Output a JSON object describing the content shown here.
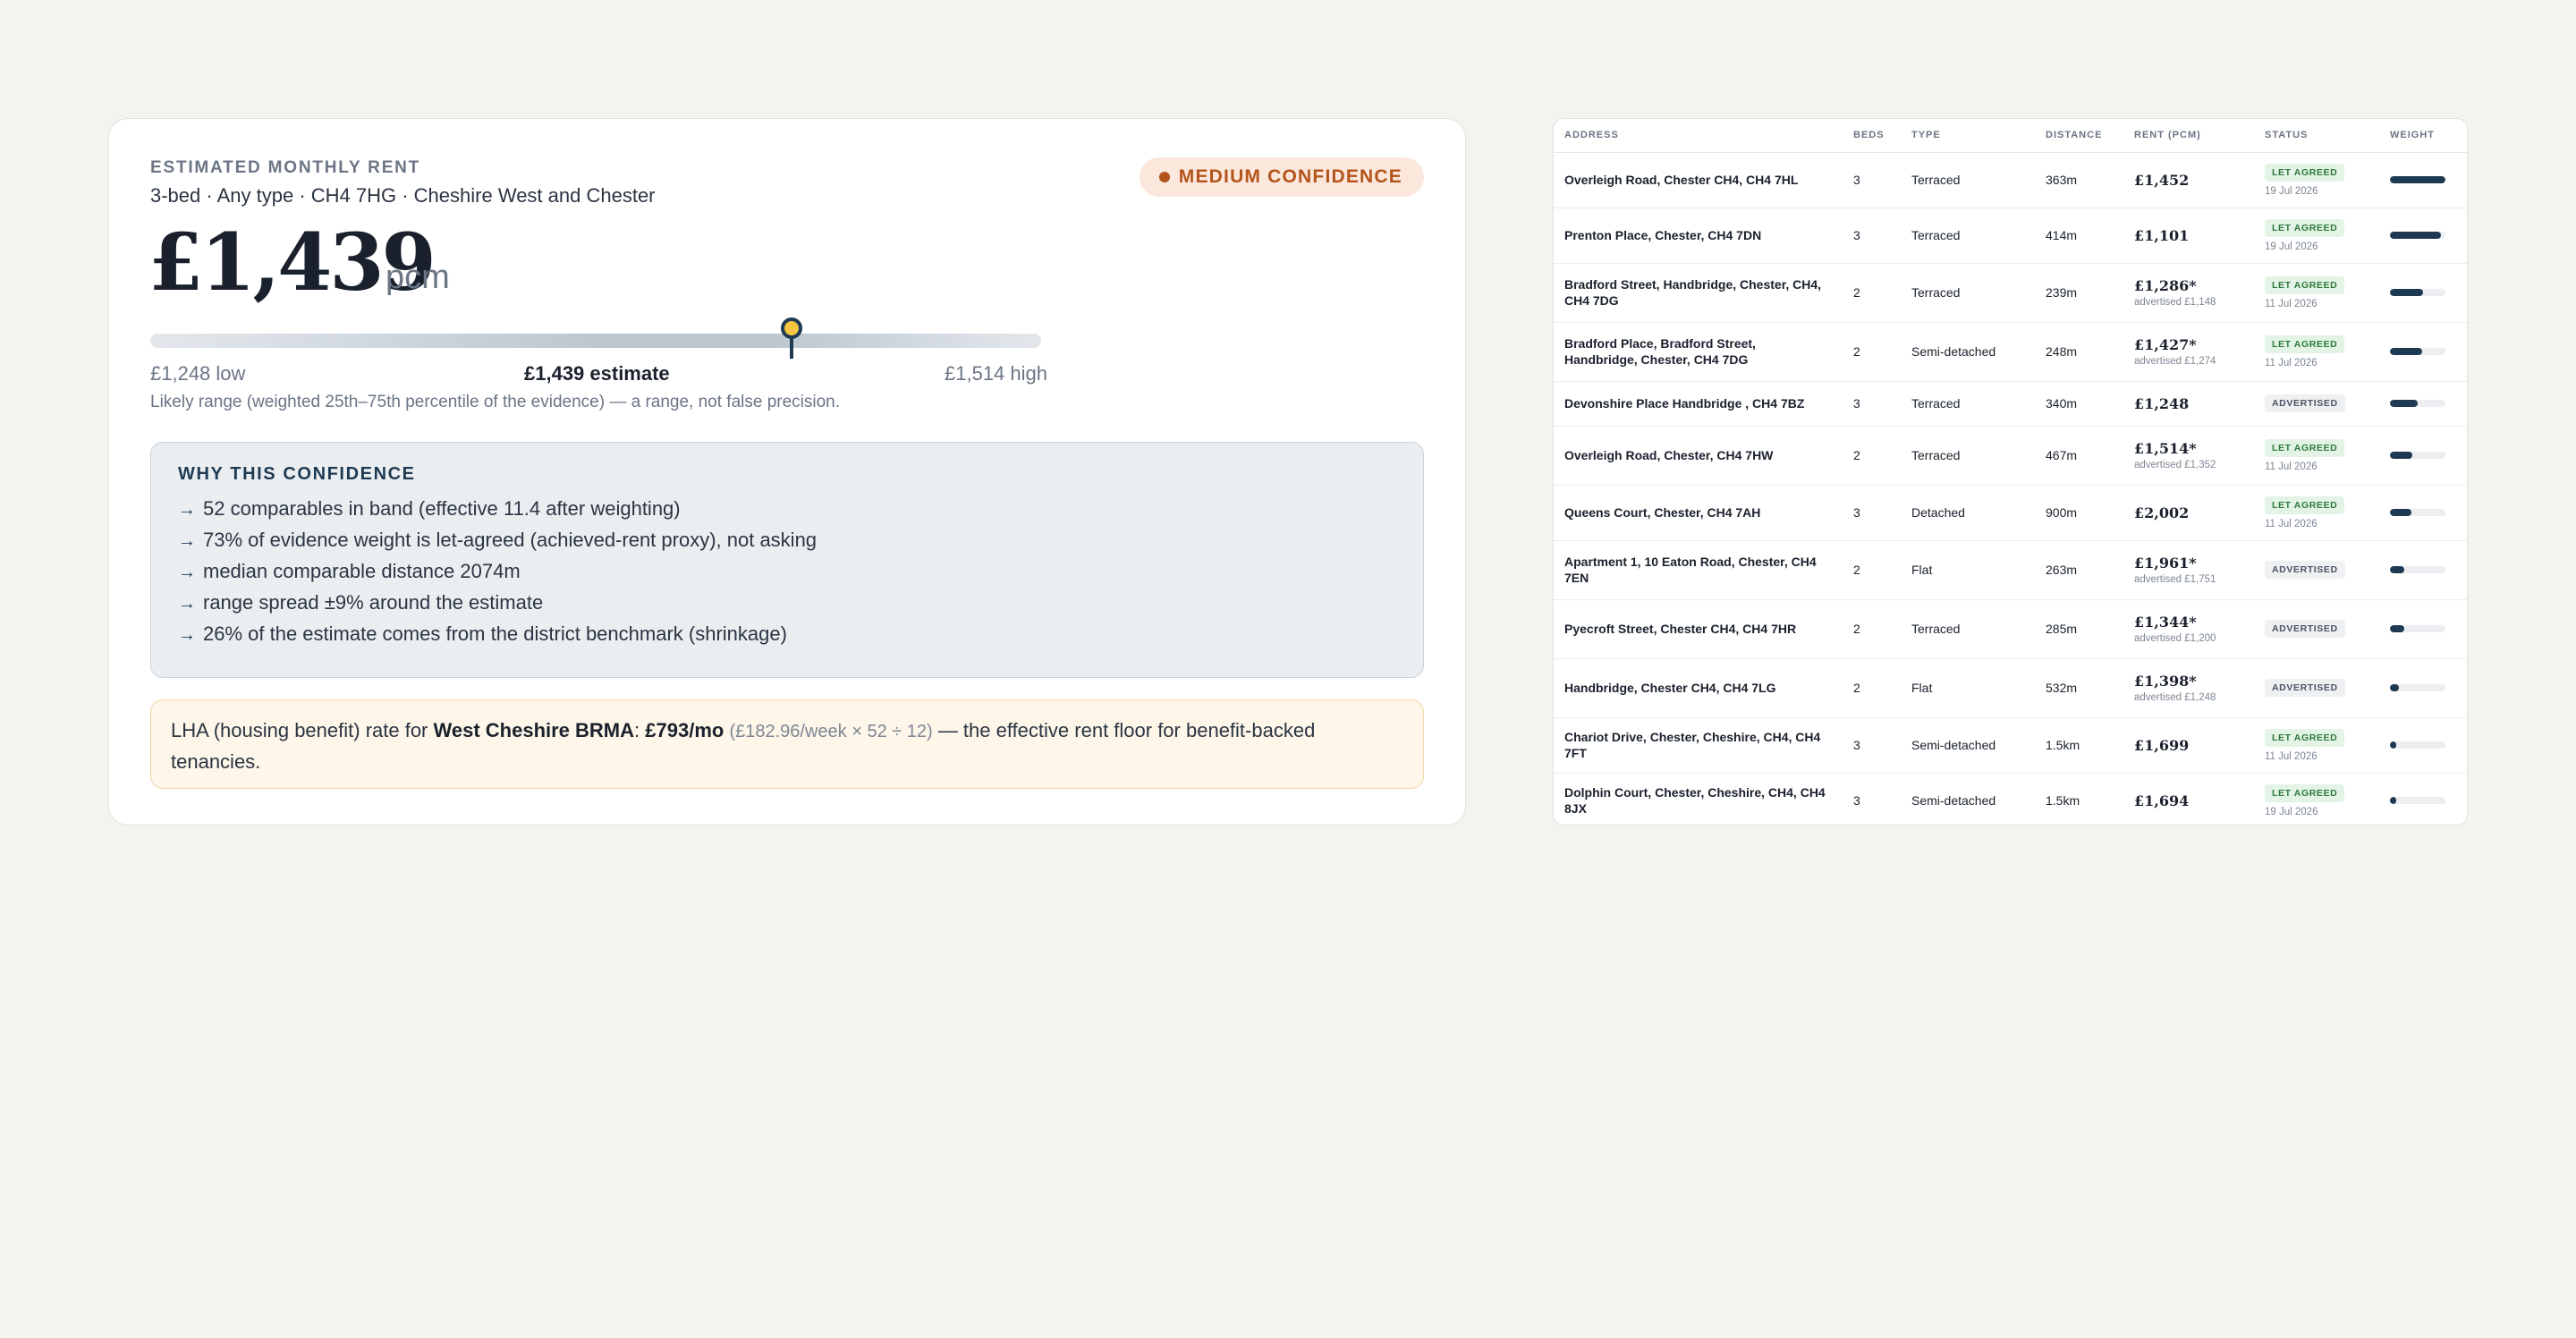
{
  "estimate": {
    "label": "ESTIMATED MONTHLY RENT",
    "subtitle": "3-bed · Any type · CH4 7HG · Cheshire West and Chester",
    "confidence": "MEDIUM CONFIDENCE",
    "value": "£1,439",
    "unit": "pcm",
    "range": {
      "low_label": "£1,248 low",
      "estimate_label": "£1,439 estimate",
      "high_label": "£1,514 high",
      "estimate_position": 0.72,
      "note": "Likely range (weighted 25th–75th percentile of the evidence) — a range, not false precision."
    },
    "why": {
      "title": "WHY THIS CONFIDENCE",
      "arrow": "→",
      "items": [
        "52 comparables in band (effective 11.4 after weighting)",
        "73% of evidence weight is let-agreed (achieved-rent proxy), not asking",
        "median comparable distance 2074m",
        "range spread ±9% around the estimate",
        "26% of the estimate comes from the district benchmark (shrinkage)"
      ]
    },
    "lha": {
      "prefix": "LHA (housing benefit) rate for ",
      "area": "West Cheshire BRMA",
      "colon": ": ",
      "rate": "£793/mo",
      "calc": "(£182.96/week × 52 ÷ 12)",
      "suffix": " — the effective rent floor for benefit-backed tenancies."
    },
    "colors": {
      "accent": "#1e3a52",
      "confidence": "#b3541a",
      "marker": "#f5c542"
    }
  },
  "comparables": {
    "headers": [
      "ADDRESS",
      "BEDS",
      "TYPE",
      "DISTANCE",
      "RENT (PCM)",
      "STATUS",
      "WEIGHT"
    ],
    "rows": [
      {
        "address": "Overleigh Road, Chester CH4, CH4 7HL",
        "beds": "3",
        "type": "Terraced",
        "distance": "363m",
        "rent": "£1,452",
        "rent_sub": "",
        "status": "LET AGREED",
        "status_kind": "let",
        "date": "19 Jul 2026",
        "weight": 1.0
      },
      {
        "address": "Prenton Place, Chester, CH4 7DN",
        "beds": "3",
        "type": "Terraced",
        "distance": "414m",
        "rent": "£1,101",
        "rent_sub": "",
        "status": "LET AGREED",
        "status_kind": "let",
        "date": "19 Jul 2026",
        "weight": 0.92
      },
      {
        "address": "Bradford Street, Handbridge, Chester, CH4, CH4 7DG",
        "beds": "2",
        "type": "Terraced",
        "distance": "239m",
        "rent": "£1,286*",
        "rent_sub": "advertised £1,148",
        "status": "LET AGREED",
        "status_kind": "let",
        "date": "11 Jul 2026",
        "weight": 0.6
      },
      {
        "address": "Bradford Place, Bradford Street, Handbridge, Chester, CH4 7DG",
        "beds": "2",
        "type": "Semi-detached",
        "distance": "248m",
        "rent": "£1,427*",
        "rent_sub": "advertised £1,274",
        "status": "LET AGREED",
        "status_kind": "let",
        "date": "11 Jul 2026",
        "weight": 0.58
      },
      {
        "address": "Devonshire Place Handbridge , CH4 7BZ",
        "beds": "3",
        "type": "Terraced",
        "distance": "340m",
        "rent": "£1,248",
        "rent_sub": "",
        "status": "ADVERTISED",
        "status_kind": "adv",
        "date": "",
        "weight": 0.5
      },
      {
        "address": "Overleigh Road, Chester, CH4 7HW",
        "beds": "2",
        "type": "Terraced",
        "distance": "467m",
        "rent": "£1,514*",
        "rent_sub": "advertised £1,352",
        "status": "LET AGREED",
        "status_kind": "let",
        "date": "11 Jul 2026",
        "weight": 0.4
      },
      {
        "address": "Queens Court, Chester, CH4 7AH",
        "beds": "3",
        "type": "Detached",
        "distance": "900m",
        "rent": "£2,002",
        "rent_sub": "",
        "status": "LET AGREED",
        "status_kind": "let",
        "date": "11 Jul 2026",
        "weight": 0.38
      },
      {
        "address": "Apartment 1, 10 Eaton Road, Chester, CH4 7EN",
        "beds": "2",
        "type": "Flat",
        "distance": "263m",
        "rent": "£1,961*",
        "rent_sub": "advertised £1,751",
        "status": "ADVERTISED",
        "status_kind": "adv",
        "date": "",
        "weight": 0.26
      },
      {
        "address": "Pyecroft Street, Chester CH4, CH4 7HR",
        "beds": "2",
        "type": "Terraced",
        "distance": "285m",
        "rent": "£1,344*",
        "rent_sub": "advertised £1,200",
        "status": "ADVERTISED",
        "status_kind": "adv",
        "date": "",
        "weight": 0.26
      },
      {
        "address": "Handbridge, Chester CH4, CH4 7LG",
        "beds": "2",
        "type": "Flat",
        "distance": "532m",
        "rent": "£1,398*",
        "rent_sub": "advertised £1,248",
        "status": "ADVERTISED",
        "status_kind": "adv",
        "date": "",
        "weight": 0.16
      },
      {
        "address": "Chariot Drive, Chester, Cheshire, CH4, CH4 7FT",
        "beds": "3",
        "type": "Semi-detached",
        "distance": "1.5km",
        "rent": "£1,699",
        "rent_sub": "",
        "status": "LET AGREED",
        "status_kind": "let",
        "date": "11 Jul 2026",
        "weight": 0.12
      },
      {
        "address": "Dolphin Court, Chester, Cheshire, CH4, CH4 8JX",
        "beds": "3",
        "type": "Semi-detached",
        "distance": "1.5km",
        "rent": "£1,694",
        "rent_sub": "",
        "status": "LET AGREED",
        "status_kind": "let",
        "date": "19 Jul 2026",
        "weight": 0.12
      }
    ]
  }
}
